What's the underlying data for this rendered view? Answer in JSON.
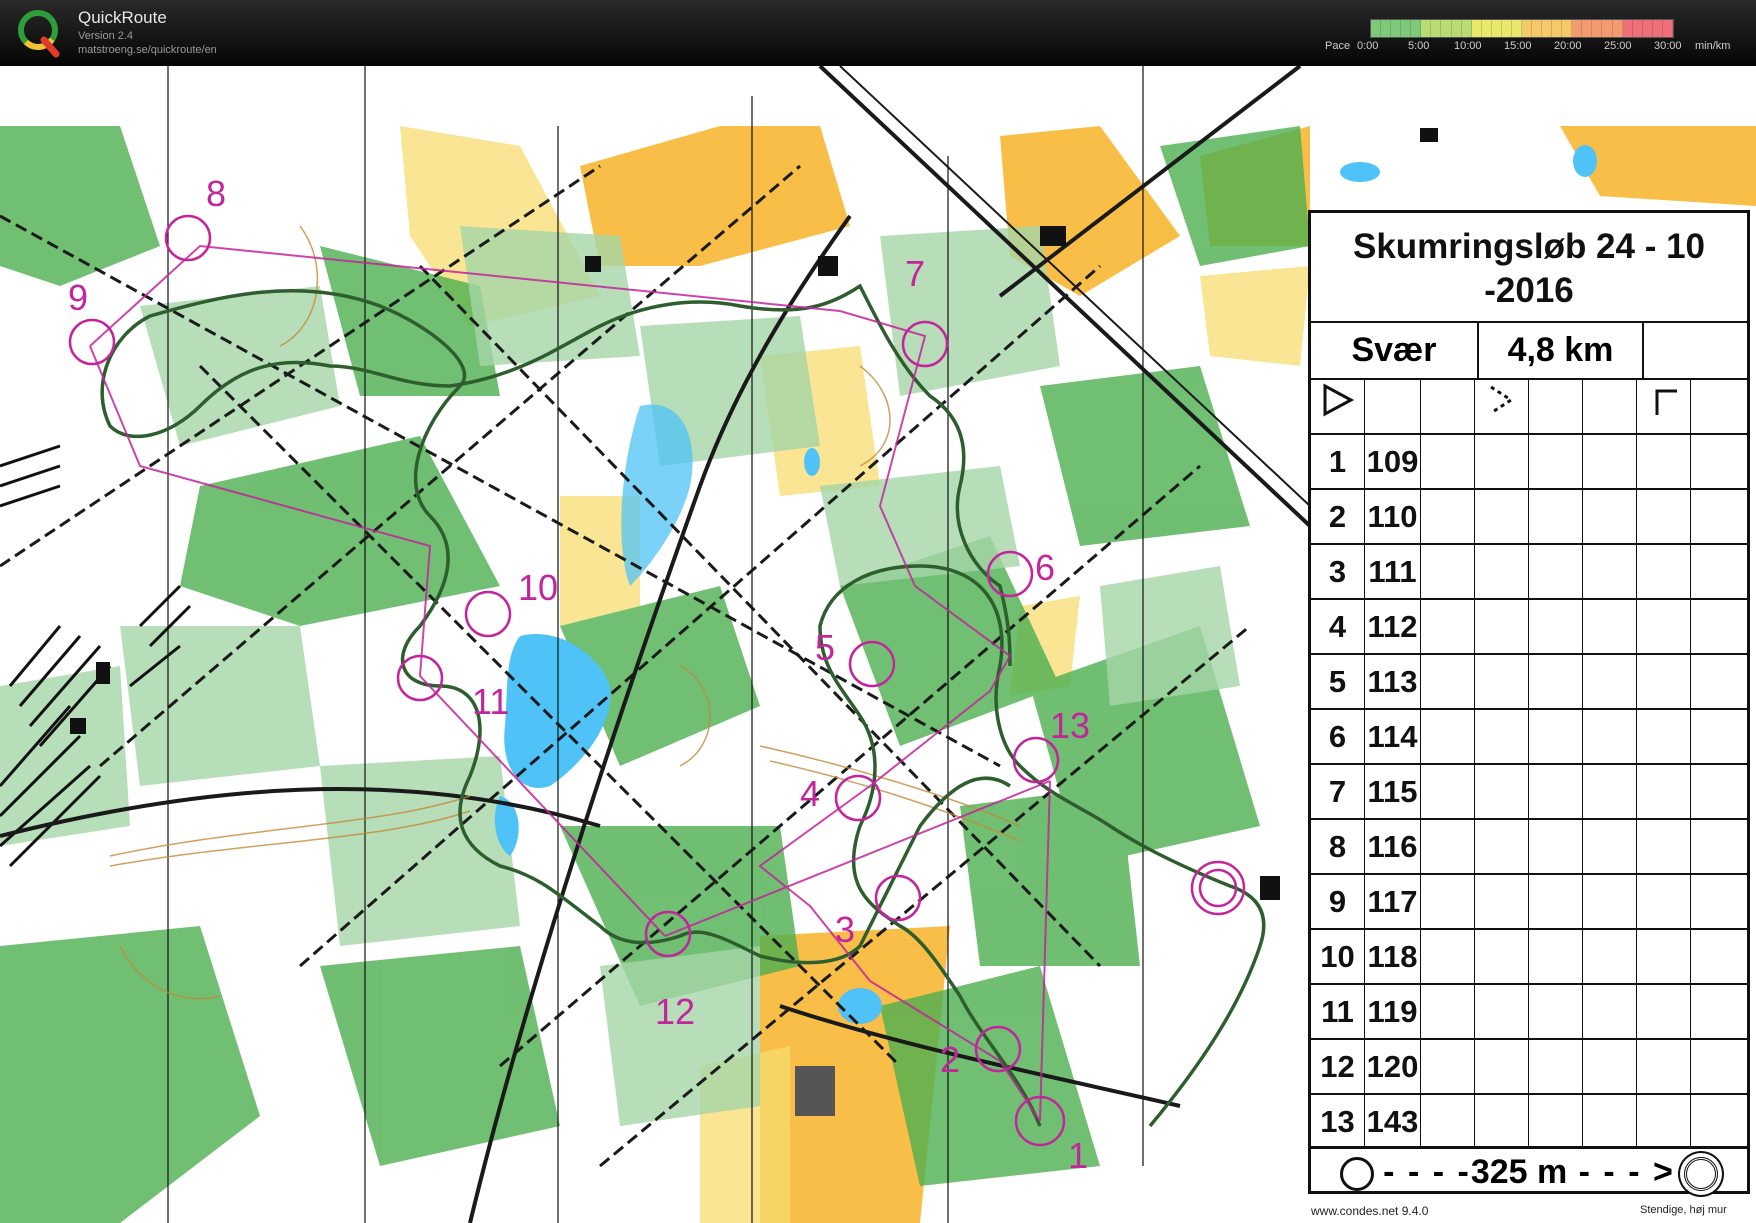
{
  "app": {
    "name": "QuickRoute",
    "version": "Version 2.4",
    "url": "matstroeng.se/quickroute/en"
  },
  "pace_legend": {
    "label": "Pace",
    "ticks": [
      "0:00",
      "5:00",
      "10:00",
      "15:00",
      "20:00",
      "25:00",
      "30:00"
    ],
    "unit": "min/km",
    "colors": [
      "#7fc97a",
      "#b9dd74",
      "#e8e86a",
      "#f5c86a",
      "#f49a70",
      "#ef6f78"
    ]
  },
  "map": {
    "control_numbers": [
      "1",
      "2",
      "3",
      "4",
      "5",
      "6",
      "7",
      "8",
      "9",
      "10",
      "11",
      "12",
      "13"
    ],
    "colors": {
      "forest": "#4caf50",
      "light_forest": "#a5d6a7",
      "open": "#f7b733",
      "rough_open": "#f7dc6f",
      "water": "#4fc3f7",
      "course": "#c2259c",
      "route": "#2e5d2e"
    }
  },
  "control_description": {
    "title": "Skumringsløb 24 - 10 -2016",
    "class": "Svær",
    "length": "4,8 km",
    "start_symbol": "start-triangle",
    "rows": [
      {
        "num": "1",
        "code": "109"
      },
      {
        "num": "2",
        "code": "110"
      },
      {
        "num": "3",
        "code": "111"
      },
      {
        "num": "4",
        "code": "112"
      },
      {
        "num": "5",
        "code": "113"
      },
      {
        "num": "6",
        "code": "114"
      },
      {
        "num": "7",
        "code": "115"
      },
      {
        "num": "8",
        "code": "116"
      },
      {
        "num": "9",
        "code": "117"
      },
      {
        "num": "10",
        "code": "118"
      },
      {
        "num": "11",
        "code": "119"
      },
      {
        "num": "12",
        "code": "120"
      },
      {
        "num": "13",
        "code": "143"
      }
    ],
    "finish_distance": "325 m",
    "footer": "www.condes.net 9.4.0",
    "footer2": "Stendige, høj mur"
  }
}
